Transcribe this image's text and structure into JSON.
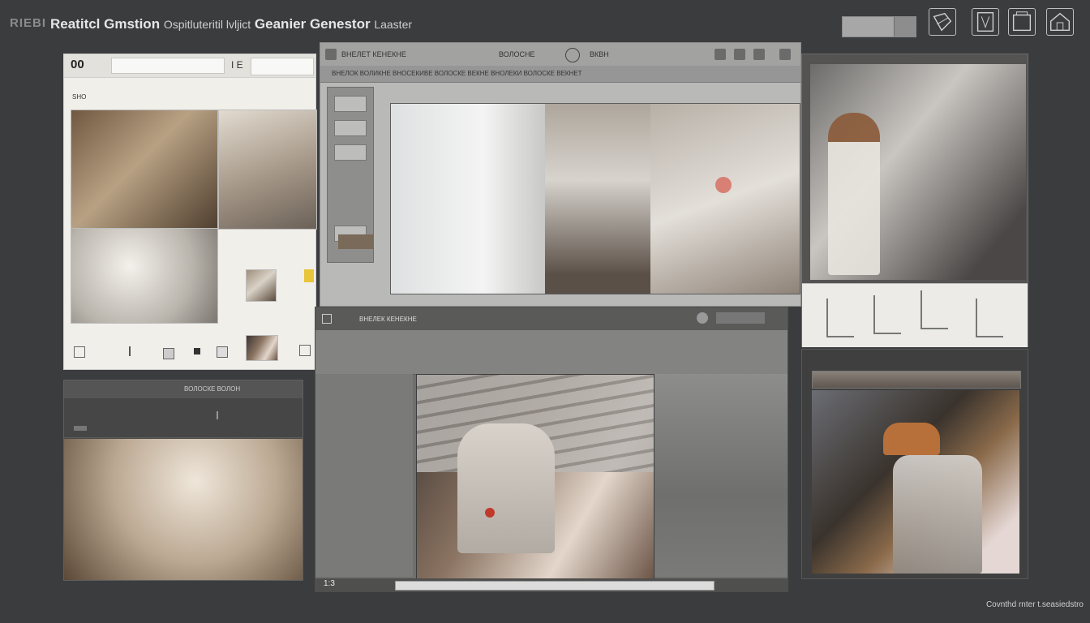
{
  "header": {
    "logo": "RIEBI",
    "title_bold": "Reatitcl Gmstion",
    "title_mid": "Ospitluteritil lvljict",
    "title_tail": "Geanier Genestor",
    "title_end": "Laaster"
  },
  "left_top_panel": {
    "code": "00",
    "field_value": "",
    "tag": "I E",
    "mini_label": "SHO"
  },
  "center_top_panel": {
    "toolbar_text_1": "ВНЕЛЕТ КЕНЕКНЕ",
    "toolbar_text_2": "ВОЛОСНЕ",
    "toolbar_label": "ВКВН",
    "subbar_text": "ВНЕЛОК ВОЛИКНЕ ВНОСЕКИВЕ ВОЛОСКЕ ВЕКНЕ ВНОЛЕКИ ВОЛОСКЕ ВЕКНЕТ"
  },
  "center_bottom_panel": {
    "toolbar_text": "ВНЕЛЕК КЕНЕКНЕ",
    "zoom": "1:3"
  },
  "left_bottom_panel": {
    "toolbar_text": "ВОЛОСКЕ ВОЛОН"
  },
  "footer": {
    "text": "Covnthd rnter t.seasiedstro"
  },
  "colors": {
    "background": "#3b3c3e",
    "light_panel": "#f1efea",
    "toolbar_gray": "#a2a2a1",
    "accent_yellow": "#e8c53a"
  }
}
